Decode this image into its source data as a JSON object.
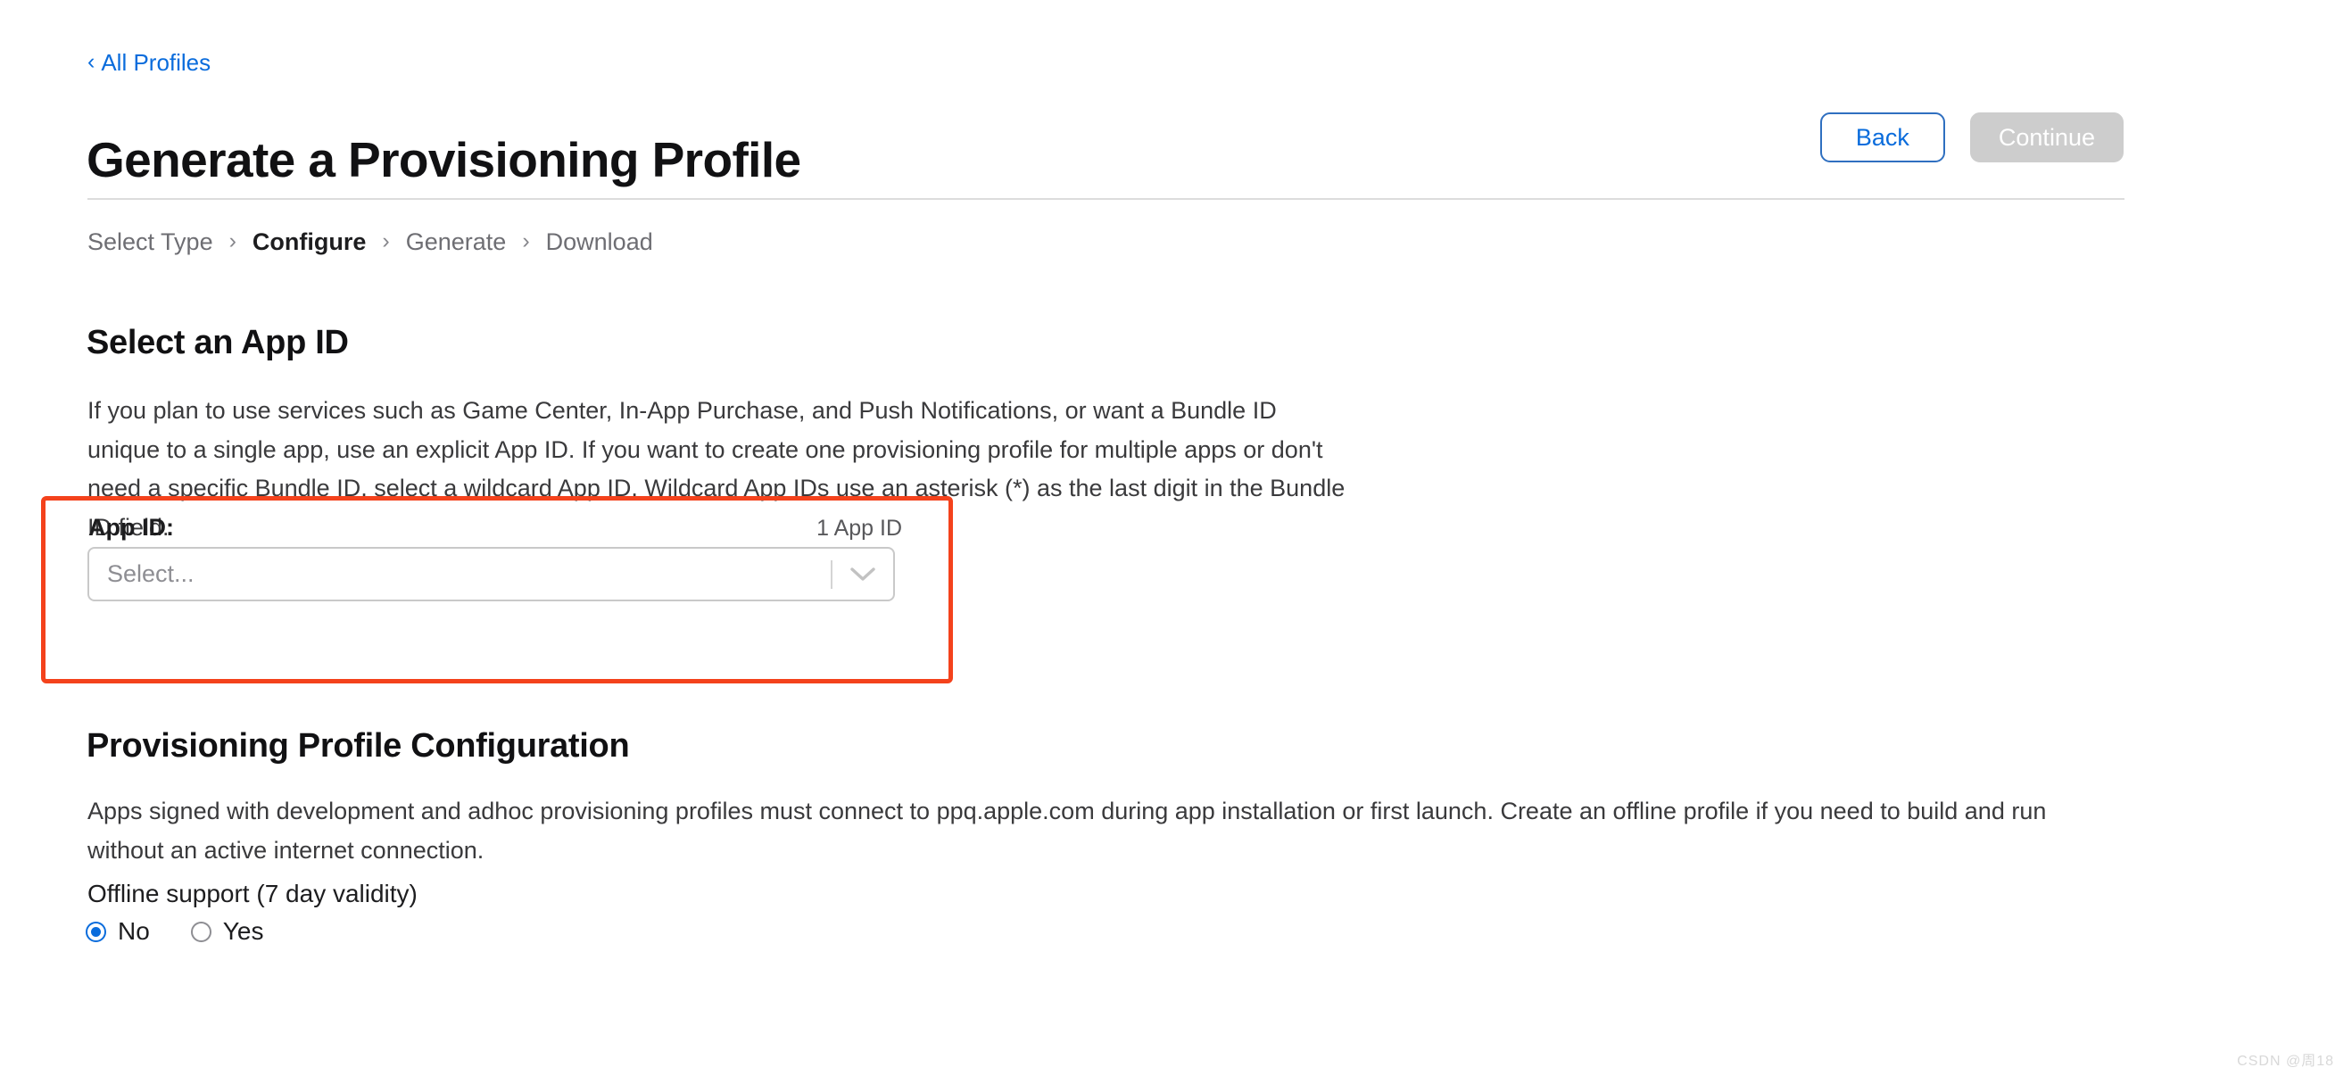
{
  "back_link": {
    "chevron": "‹",
    "label": "All Profiles"
  },
  "header": {
    "title": "Generate a Provisioning Profile",
    "back_button": "Back",
    "continue_button": "Continue"
  },
  "breadcrumb": {
    "separator": "›",
    "steps": [
      {
        "label": "Select Type",
        "current": false
      },
      {
        "label": "Configure",
        "current": true
      },
      {
        "label": "Generate",
        "current": false
      },
      {
        "label": "Download",
        "current": false
      }
    ]
  },
  "app_id_section": {
    "heading": "Select an App ID",
    "description": "If you plan to use services such as Game Center, In-App Purchase, and Push Notifications, or want a Bundle ID unique to a single app, use an explicit App ID. If you want to create one provisioning profile for multiple apps or don't need a specific Bundle ID, select a wildcard App ID. Wildcard App IDs use an asterisk (*) as the last digit in the Bundle ID field.",
    "field_label": "App ID:",
    "field_count": "1 App ID",
    "select_placeholder": "Select...",
    "select_value": "",
    "highlight_color": "#f4421c"
  },
  "configuration_section": {
    "heading": "Provisioning Profile Configuration",
    "description": "Apps signed with development and adhoc provisioning profiles must connect to ppq.apple.com during app installation or first launch. Create an offline profile if you need to build and run without an active internet connection.",
    "offline_support": {
      "label": "Offline support (7 day validity)",
      "options": [
        {
          "label": "No",
          "selected": true
        },
        {
          "label": "Yes",
          "selected": false
        }
      ]
    }
  },
  "watermark": "CSDN @周18",
  "colors": {
    "link": "#0a6cdc",
    "accent": "#0a6cdc",
    "highlight": "#f4421c",
    "disabled_button": "#cdcdcd"
  }
}
